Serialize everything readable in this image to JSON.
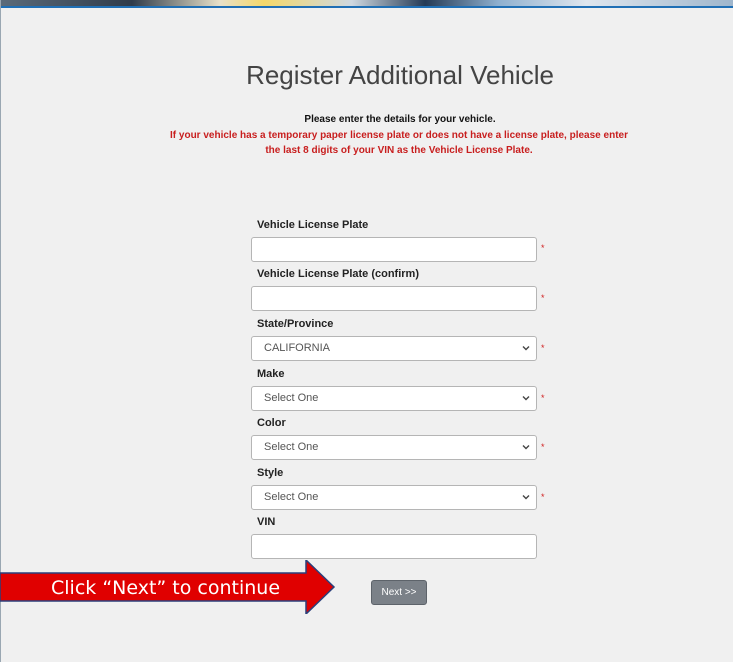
{
  "page": {
    "title": "Register Additional Vehicle",
    "intro": "Please enter the details for your vehicle.",
    "warning": "If your vehicle has a temporary paper license plate or does not have a license plate, please enter the last 8 digits of your VIN as the Vehicle License Plate."
  },
  "form": {
    "license_plate": {
      "label": "Vehicle License Plate",
      "value": "",
      "required_mark": "*"
    },
    "license_plate_confirm": {
      "label": "Vehicle License Plate (confirm)",
      "value": "",
      "required_mark": "*"
    },
    "state": {
      "label": "State/Province",
      "value": "CALIFORNIA",
      "required_mark": "*"
    },
    "make": {
      "label": "Make",
      "value": "Select One",
      "required_mark": "*"
    },
    "color": {
      "label": "Color",
      "value": "Select One",
      "required_mark": "*"
    },
    "style": {
      "label": "Style",
      "value": "Select One",
      "required_mark": "*"
    },
    "vin": {
      "label": "VIN",
      "value": ""
    }
  },
  "actions": {
    "next_label": "Next >>"
  },
  "annotation": {
    "text": "Click “Next” to continue",
    "color": "#e00000"
  },
  "icons": {
    "dropdown": "chevron-down-icon"
  }
}
